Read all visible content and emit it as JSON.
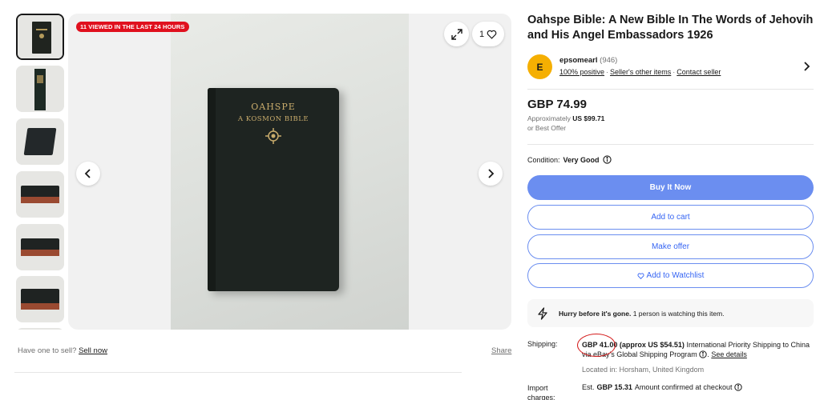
{
  "gallery": {
    "viewed_badge": "11 VIEWED IN THE LAST 24 HOURS",
    "watch_count": "1",
    "book_cover_title": "OAHSPE",
    "book_cover_subtitle": "A KOSMON BIBLE",
    "thumbnails": [
      "thumb-1",
      "thumb-2",
      "thumb-3",
      "thumb-4",
      "thumb-5",
      "thumb-6"
    ]
  },
  "below_gallery": {
    "have_one_text": "Have one to sell?",
    "sell_now": "Sell now",
    "share": "Share"
  },
  "listing": {
    "title": "Oahspe Bible: A New Bible In The Words of Jehovih and His Angel Embassadors 1926",
    "price": "GBP 74.99",
    "approx_prefix": "Approximately",
    "approx_value": "US $99.71",
    "best_offer": "or Best Offer",
    "condition_label": "Condition:",
    "condition_value": "Very Good"
  },
  "seller": {
    "avatar_letter": "E",
    "name": "epsomearl",
    "feedback_count": "(946)",
    "positive": "100% positive",
    "other_items": "Seller's other items",
    "contact": "Contact seller"
  },
  "buttons": {
    "buy_now": "Buy It Now",
    "add_to_cart": "Add to cart",
    "make_offer": "Make offer",
    "add_to_watchlist": "Add to Watchlist"
  },
  "hurry": {
    "bold": "Hurry before it's gone.",
    "text": "1 person is watching this item."
  },
  "shipping": {
    "label": "Shipping:",
    "amount": "GBP 41.00",
    "approx": "(approx US $54.51)",
    "text1": "International Priority Shipping to China via eBay's Global Shipping Program",
    "see_details": "See details",
    "located": "Located in: Horsham, United Kingdom"
  },
  "import": {
    "label": "Import charges:",
    "prefix": "Est.",
    "amount": "GBP 15.31",
    "text": "Amount confirmed at checkout"
  },
  "colors": {
    "accent_blue": "#3665f3",
    "buy_button": "#6b8ef0",
    "badge_red": "#e0101e",
    "avatar_yellow": "#f5af02"
  }
}
